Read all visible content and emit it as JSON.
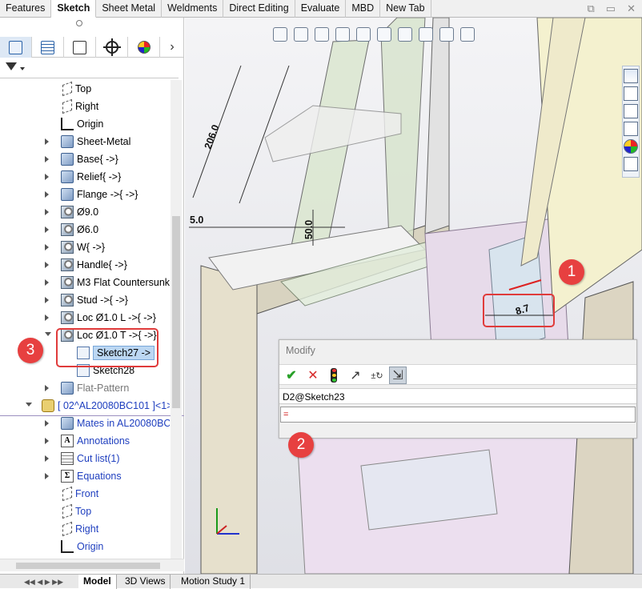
{
  "ribbon": {
    "tabs": [
      "Features",
      "Sketch",
      "Sheet Metal",
      "Weldments",
      "Direct Editing",
      "Evaluate",
      "MBD",
      "New Tab"
    ],
    "active": "Sketch"
  },
  "tree": {
    "items": [
      {
        "label": "Top",
        "icon": "plane-icon",
        "color": "normal"
      },
      {
        "label": "Right",
        "icon": "plane-icon",
        "color": "normal"
      },
      {
        "label": "Origin",
        "icon": "origin-icon",
        "color": "normal"
      },
      {
        "label": "Sheet-Metal",
        "icon": "sheet-metal-icon",
        "color": "normal"
      },
      {
        "label": "Base{ ->}",
        "icon": "base-flange-icon",
        "color": "normal"
      },
      {
        "label": "Relief{ ->}",
        "icon": "relief-icon",
        "color": "normal"
      },
      {
        "label": "Flange ->{ ->}",
        "icon": "flange-icon",
        "color": "normal"
      },
      {
        "label": "Ø9.0",
        "icon": "hole-icon",
        "color": "normal"
      },
      {
        "label": "Ø6.0",
        "icon": "hole-icon",
        "color": "normal"
      },
      {
        "label": "W{ ->}",
        "icon": "hole-icon",
        "color": "normal"
      },
      {
        "label": "Handle{ ->}",
        "icon": "hole-icon",
        "color": "normal"
      },
      {
        "label": "M3 Flat Countersunk -",
        "icon": "hole-icon",
        "color": "normal"
      },
      {
        "label": "Stud ->{ ->}",
        "icon": "hole-icon",
        "color": "normal"
      },
      {
        "label": "Loc Ø1.0 L ->{ ->}",
        "icon": "hole-icon",
        "color": "normal"
      },
      {
        "label": "Loc Ø1.0 T ->{ ->}",
        "icon": "hole-icon",
        "color": "normal"
      },
      {
        "label": "Sketch27 ->",
        "icon": "sketch-icon",
        "color": "normal"
      },
      {
        "label": "Sketch28",
        "icon": "sketch-icon",
        "color": "normal"
      },
      {
        "label": "Flat-Pattern",
        "icon": "flat-pattern-icon",
        "color": "gray"
      },
      {
        "label": "[ 02^AL20080BC101 ]<1> -",
        "icon": "assembly-icon",
        "color": "blue"
      },
      {
        "label": "Mates in AL20080BC10",
        "icon": "mates-icon",
        "color": "blue"
      },
      {
        "label": "Annotations",
        "icon": "annotations-icon",
        "color": "blue"
      },
      {
        "label": "Cut list(1)",
        "icon": "cut-list-icon",
        "color": "blue"
      },
      {
        "label": "Equations",
        "icon": "equations-icon",
        "color": "blue"
      },
      {
        "label": "Front",
        "icon": "plane-icon",
        "color": "blue"
      },
      {
        "label": "Top",
        "icon": "plane-icon",
        "color": "blue"
      },
      {
        "label": "Right",
        "icon": "plane-icon",
        "color": "blue"
      },
      {
        "label": "Origin",
        "icon": "origin-icon",
        "color": "blue"
      }
    ]
  },
  "dims": {
    "d1": "206.0",
    "d2": "5.0",
    "d3": "50.0",
    "d4": "8.7"
  },
  "modify": {
    "title": "Modify",
    "name": "D2@Sketch23",
    "value": "="
  },
  "callouts": {
    "c1": "1",
    "c2": "2",
    "c3": "3"
  },
  "bottom_tabs": [
    "Model",
    "3D Views",
    "Motion Study 1"
  ],
  "colors": {
    "callout": "#e74040",
    "selection": "#bcd7f3"
  }
}
